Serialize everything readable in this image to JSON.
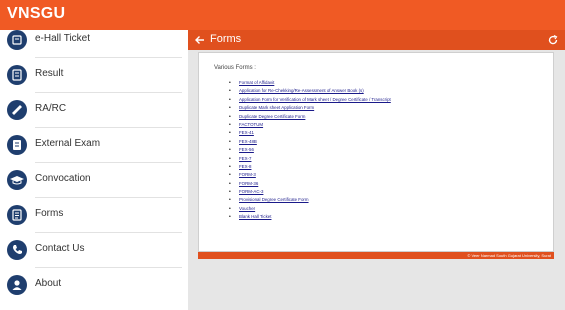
{
  "app": {
    "title": "VNSGU"
  },
  "sidebar": {
    "items": [
      {
        "label": "e-Hall Ticket",
        "icon": "hall-ticket-icon"
      },
      {
        "label": "Result",
        "icon": "result-icon"
      },
      {
        "label": "RA/RC",
        "icon": "ra-rc-icon"
      },
      {
        "label": "External Exam",
        "icon": "external-exam-icon"
      },
      {
        "label": "Convocation",
        "icon": "graduation-cap-icon"
      },
      {
        "label": "Forms",
        "icon": "forms-icon"
      },
      {
        "label": "Contact Us",
        "icon": "phone-icon"
      },
      {
        "label": "About",
        "icon": "user-icon"
      }
    ]
  },
  "toolbar": {
    "title": "Forms"
  },
  "content": {
    "intro": "Various Forms :",
    "forms": [
      "Format of Affidavit",
      "Application for Re-Chekking/Re-Assessment of Answer Book (s)",
      "Application Form for Verification of Mark sheet / Degree Certificate / Transcript",
      "Duplicate Mark sheet Application Form",
      "Duplicate Degree Certificate Form",
      "FACTOTUM",
      "FEX-41",
      "FEX-48B",
      "FEX-56",
      "FEX-7",
      "FEX-8",
      "FORM-3",
      "FORM-36",
      "FORM-AC-3",
      "Provisional Degree Certificate Form",
      "Voucher",
      "Blank Hall Ticket"
    ]
  },
  "footer": {
    "text": "© Veer Narmad South Gujarat University, Surat"
  },
  "colors": {
    "accent": "#f05a24",
    "toolbar": "#e0501e",
    "icon_bg": "#1f3e6e"
  }
}
